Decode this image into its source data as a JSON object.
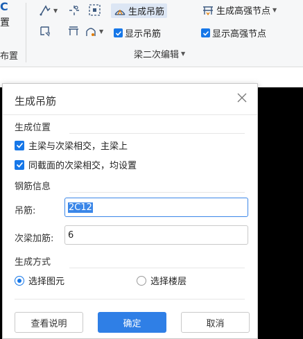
{
  "ribbon": {
    "left_partial_top": "置",
    "left_partial_top_letter": "C",
    "left_partial_bottom": "布置",
    "generate_hanger_label": "生成吊筋",
    "generate_strong_node_label": "生成高强节点",
    "show_hanger_label": "显示吊筋",
    "show_strong_node_label": "显示高强节点",
    "group_label": "梁二次编辑",
    "show_hanger_checked": true,
    "show_strong_node_checked": true
  },
  "dialog": {
    "title": "生成吊筋",
    "section_position": "生成位置",
    "opt_main_secondary": "主梁与次梁相交，主梁上",
    "opt_main_secondary_checked": true,
    "opt_same_section": "同截面的次梁相交，均设置",
    "opt_same_section_checked": true,
    "section_rebar": "钢筋信息",
    "hanger_label": "吊筋:",
    "hanger_value": "2C12",
    "secondary_label": "次梁加筋:",
    "secondary_value": "6",
    "section_method": "生成方式",
    "radio_element": "选择图元",
    "radio_floor": "选择楼层",
    "radio_selected": "选择图元",
    "btn_help": "查看说明",
    "btn_ok": "确定",
    "btn_cancel": "取消"
  },
  "colors": {
    "accent": "#1677e8",
    "primary_button": "#2f7fe6",
    "canvas": "#000000"
  }
}
